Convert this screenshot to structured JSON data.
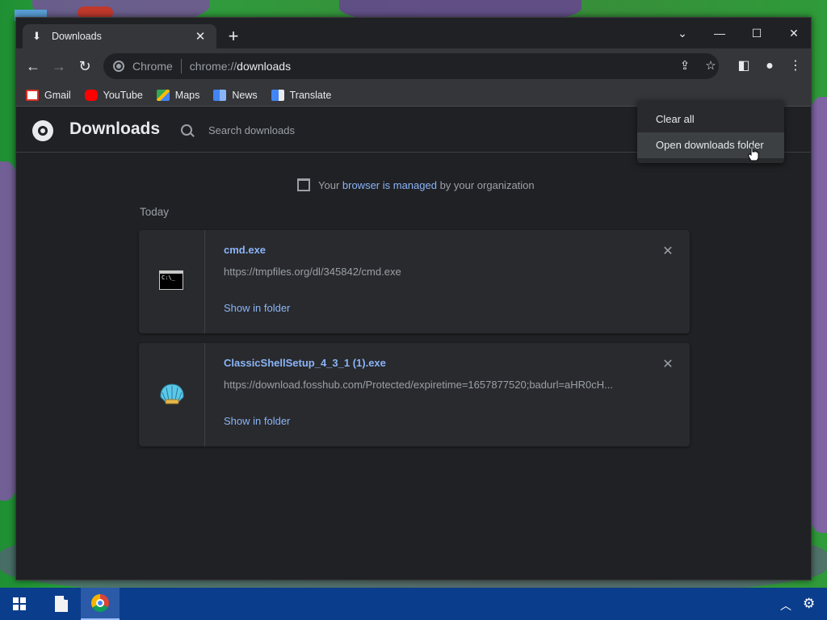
{
  "window": {
    "tab_title": "Downloads",
    "new_tab_symbol": "+",
    "controls": {
      "dropdown": "⌄",
      "minimize": "—",
      "maximize": "☐",
      "close": "✕"
    }
  },
  "toolbar": {
    "omnibox_label": "Chrome",
    "url_scheme": "chrome://",
    "url_host": "downloads"
  },
  "bookmarks": [
    {
      "label": "Gmail",
      "icon": "gmail-icon"
    },
    {
      "label": "YouTube",
      "icon": "youtube-icon"
    },
    {
      "label": "Maps",
      "icon": "maps-icon"
    },
    {
      "label": "News",
      "icon": "news-icon"
    },
    {
      "label": "Translate",
      "icon": "translate-icon"
    }
  ],
  "page": {
    "title": "Downloads",
    "search_placeholder": "Search downloads",
    "managed": {
      "prefix": "Your ",
      "link": "browser is managed",
      "suffix": " by your organization"
    },
    "section": "Today",
    "downloads": [
      {
        "name": "cmd.exe",
        "url": "https://tmpfiles.org/dl/345842/cmd.exe",
        "action": "Show in folder",
        "icon": "cmd-icon"
      },
      {
        "name": "ClassicShellSetup_4_3_1 (1).exe",
        "url": "https://download.fosshub.com/Protected/expiretime=1657877520;badurl=aHR0cH...",
        "action": "Show in folder",
        "icon": "shell-setup-icon"
      }
    ]
  },
  "menu": {
    "items": [
      {
        "label": "Clear all"
      },
      {
        "label": "Open downloads folder"
      }
    ]
  },
  "colors": {
    "accent_link": "#8ab4f8",
    "page_bg": "#202124",
    "card_bg": "#292a2d",
    "taskbar": "#0a3d8c"
  }
}
